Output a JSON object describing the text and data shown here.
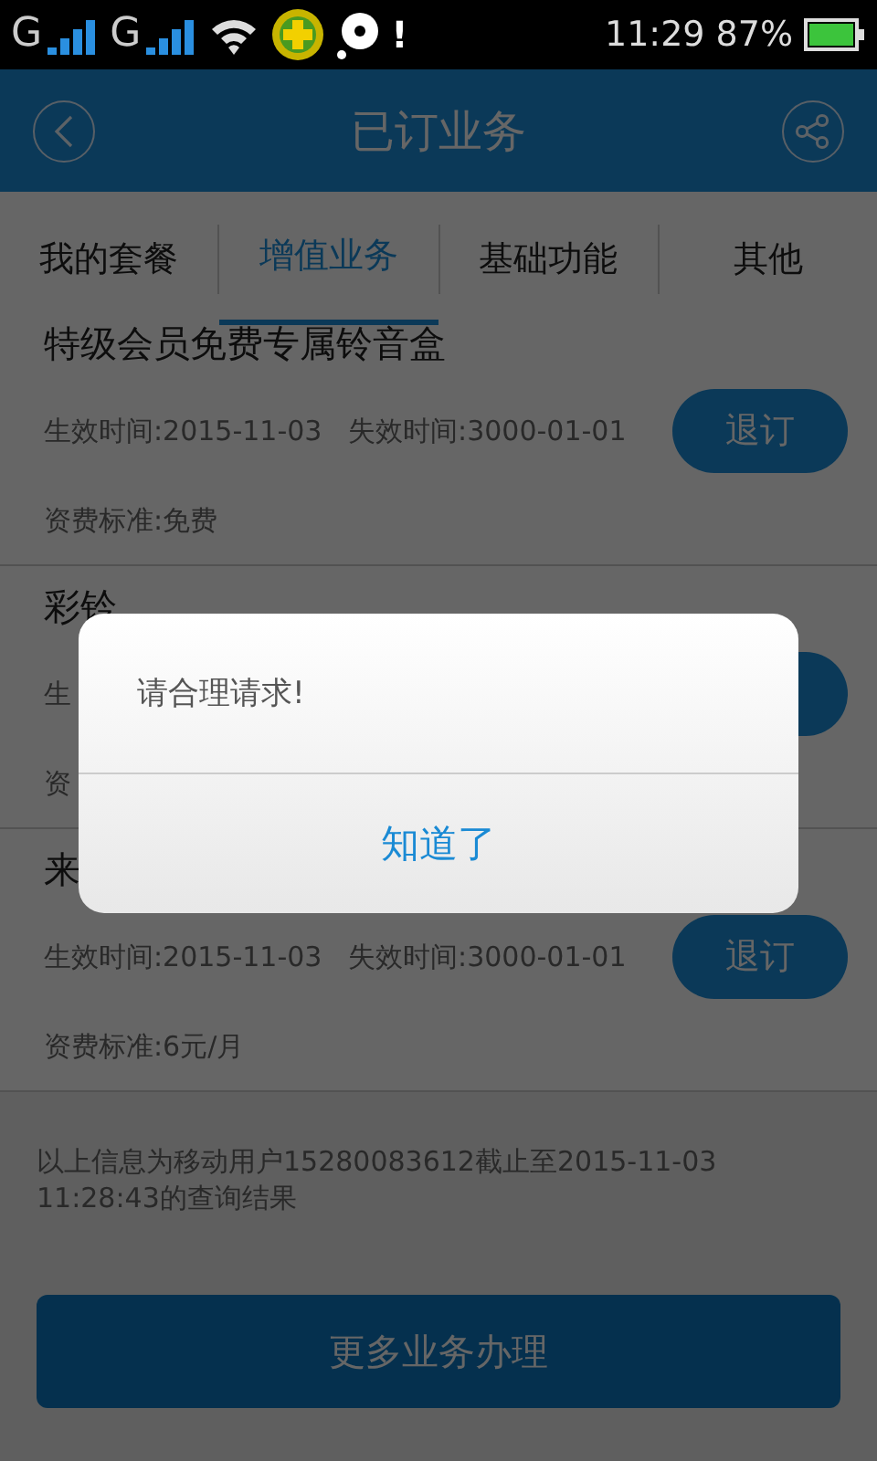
{
  "status_bar": {
    "sim_labels": [
      "G",
      "G"
    ],
    "notice": "!",
    "time": "11:29",
    "battery": "87%"
  },
  "header": {
    "title": "已订业务"
  },
  "tabs": [
    {
      "label": "我的套餐",
      "selected": false
    },
    {
      "label": "增值业务",
      "selected": true
    },
    {
      "label": "基础功能",
      "selected": false
    },
    {
      "label": "其他",
      "selected": false
    }
  ],
  "services": [
    {
      "name": "特级会员免费专属铃音盒",
      "dates": "生效时间:2015-11-03   失效时间:3000-01-01",
      "fee": "资费标准:免费",
      "has_button": true,
      "button": "退订"
    },
    {
      "name": "彩铃",
      "dates": "生",
      "fee": "资",
      "has_button": true
    },
    {
      "name": "来",
      "dates": "生效时间:2015-11-03   失效时间:3000-01-01",
      "fee": "资费标准:6元/月",
      "has_button": true,
      "button": "退订"
    }
  ],
  "note": "以上信息为移动用户15280083612截止至2015-11-03 11:28:43的查询结果",
  "more_button": "更多业务办理",
  "dialog": {
    "message": "请合理请求!",
    "button": "知道了"
  }
}
